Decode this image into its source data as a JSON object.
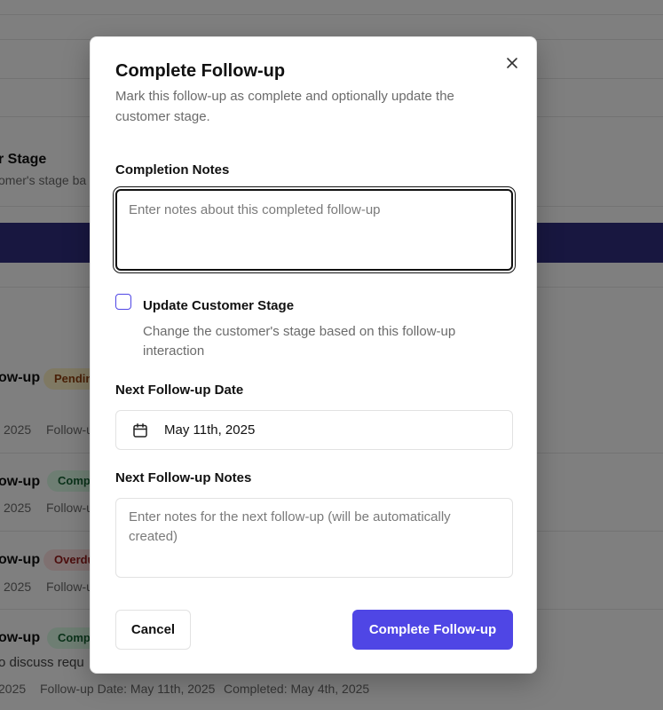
{
  "background": {
    "stage_section": {
      "title": "r Stage",
      "desc": "omer's stage ba"
    },
    "followups": [
      {
        "title": "ow-up",
        "badge": "Pendin",
        "status": "pending",
        "date": "2025",
        "meta": "Follow-u"
      },
      {
        "title": "ow-up",
        "badge": "Comp",
        "status": "complete",
        "date": "2025",
        "meta": "Follow-u"
      },
      {
        "title": "ow-up",
        "badge": "Overdu",
        "status": "overdue",
        "date": "2025",
        "meta": "Follow-u"
      },
      {
        "title": "ow-up",
        "badge": "Comp",
        "status": "complete",
        "desc": "o discuss requ",
        "date": "2025",
        "meta": "Follow-up Date: May 11th, 2025",
        "completed": "Completed: May 4th, 2025"
      }
    ]
  },
  "dialog": {
    "title": "Complete Follow-up",
    "description": "Mark this follow-up as complete and optionally update the customer stage.",
    "close_icon": "close-icon",
    "completion_notes": {
      "label": "Completion Notes",
      "placeholder": "Enter notes about this completed follow-up",
      "value": ""
    },
    "update_stage": {
      "label": "Update Customer Stage",
      "description": "Change the customer's stage based on this follow-up interaction",
      "checked": false
    },
    "next_date": {
      "label": "Next Follow-up Date",
      "icon": "calendar-icon",
      "value": "May 11th, 2025"
    },
    "next_notes": {
      "label": "Next Follow-up Notes",
      "placeholder": "Enter notes for the next follow-up (will be automatically created)",
      "value": ""
    },
    "cancel_label": "Cancel",
    "submit_label": "Complete Follow-up"
  },
  "colors": {
    "primary": "#4f46e5",
    "band": "#312e81",
    "overlay": "rgba(0,0,0,0.5)"
  }
}
